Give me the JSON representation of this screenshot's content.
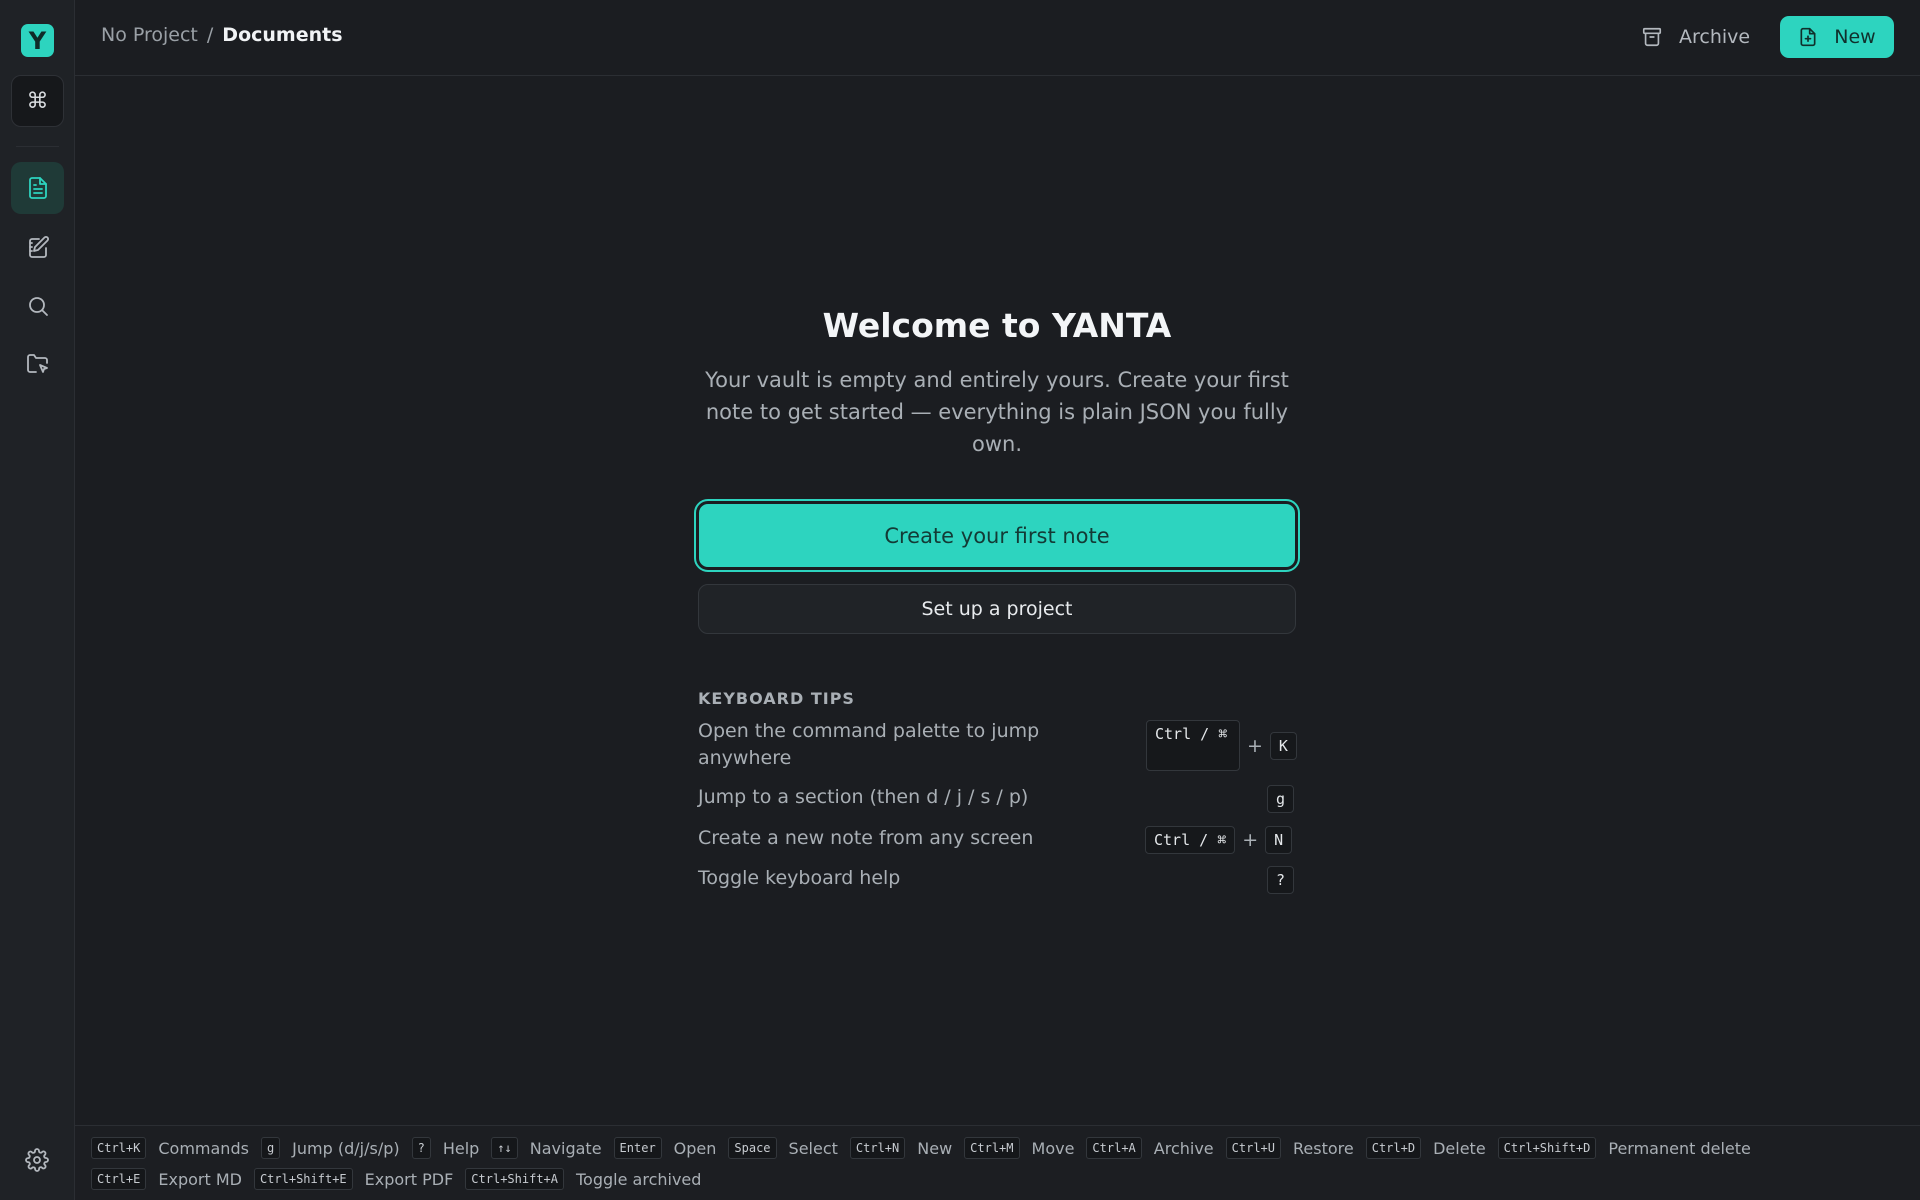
{
  "sidebar": {
    "logo_letter": "Y",
    "command_icon": "⌘",
    "nav_icons": [
      "document-icon",
      "edit-note-icon",
      "search-icon",
      "folder-icon"
    ],
    "settings_icon": "gear-icon"
  },
  "header": {
    "breadcrumb_project": "No Project",
    "breadcrumb_separator": "/",
    "breadcrumb_current": "Documents",
    "archive_label": "Archive",
    "new_label": "New"
  },
  "welcome": {
    "title": "Welcome to YANTA",
    "body": "Your vault is empty and entirely yours. Create your first note to get started — everything is plain JSON you fully own.",
    "primary_button": "Create your first note",
    "secondary_button": "Set up a project"
  },
  "tips": {
    "heading": "KEYBOARD TIPS",
    "items": [
      {
        "text": "Open the command palette to jump anywhere",
        "key1": "Ctrl / ⌘",
        "plus": "+",
        "key2": "K"
      },
      {
        "text": "Jump to a section (then d / j / s / p)",
        "key1": "g"
      },
      {
        "text": "Create a new note from any screen",
        "key1": "Ctrl / ⌘",
        "plus": "+",
        "key2": "N"
      },
      {
        "text": "Toggle keyboard help",
        "key1": "?"
      }
    ]
  },
  "footer": {
    "row1": [
      {
        "key": "Ctrl+K",
        "label": "Commands"
      },
      {
        "key": "g",
        "label": "Jump (d/j/s/p)"
      },
      {
        "key": "?",
        "label": "Help"
      },
      {
        "key": "↑↓",
        "label": "Navigate"
      },
      {
        "key": "Enter",
        "label": "Open"
      },
      {
        "key": "Space",
        "label": "Select"
      },
      {
        "key": "Ctrl+N",
        "label": "New"
      },
      {
        "key": "Ctrl+M",
        "label": "Move"
      },
      {
        "key": "Ctrl+A",
        "label": "Archive"
      },
      {
        "key": "Ctrl+U",
        "label": "Restore"
      },
      {
        "key": "Ctrl+D",
        "label": "Delete"
      },
      {
        "key": "Ctrl+Shift+D",
        "label": "Permanent delete"
      }
    ],
    "row2": [
      {
        "key": "Ctrl+E",
        "label": "Export MD"
      },
      {
        "key": "Ctrl+Shift+E",
        "label": "Export PDF"
      },
      {
        "key": "Ctrl+Shift+A",
        "label": "Toggle archived"
      }
    ]
  },
  "colors": {
    "accent": "#2dd4bf",
    "background": "#1b1d21",
    "sidebar": "#1f2226"
  }
}
